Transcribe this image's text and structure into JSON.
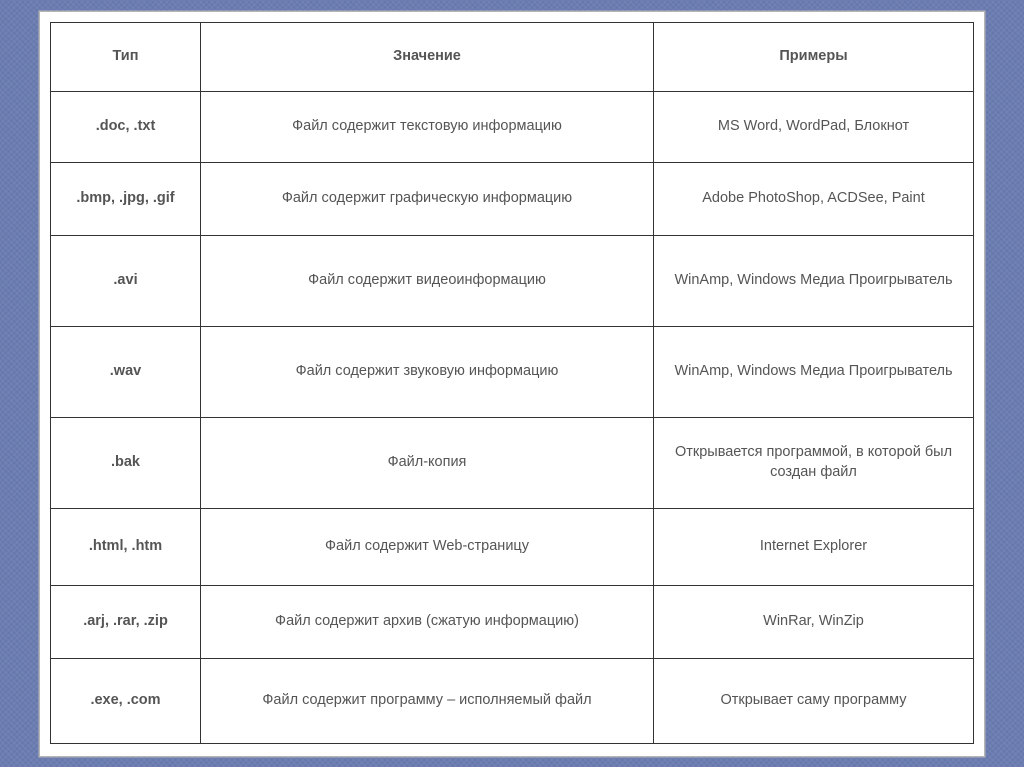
{
  "table": {
    "headers": [
      "Тип",
      "Значение",
      "Примеры"
    ],
    "rows": [
      {
        "type": ".doc,  .txt",
        "meaning": "Файл содержит текстовую информацию",
        "examples": "MS Word, WordPad, Блокнот"
      },
      {
        "type": ".bmp, .jpg, .gif",
        "meaning": "Файл содержит графическую информацию",
        "examples": "Adobe PhotoShop, ACDSee, Paint"
      },
      {
        "type": ".avi",
        "meaning": "Файл содержит видеоинформацию",
        "examples": "WinAmp, Windows Медиа Проигрыватель"
      },
      {
        "type": ".wav",
        "meaning": "Файл содержит звуковую информацию",
        "examples": "WinAmp, Windows Медиа Проигрыватель"
      },
      {
        "type": ".bak",
        "meaning": "Файл-копия",
        "examples": "Открывается программой, в которой был создан файл"
      },
      {
        "type": ".html, .htm",
        "meaning": "Файл содержит Web-страницу",
        "examples": "Internet Explorer"
      },
      {
        "type": ".arj, .rar, .zip",
        "meaning": "Файл содержит архив (сжатую информацию)",
        "examples": "WinRar, WinZip"
      },
      {
        "type": ".exe, .com",
        "meaning": "Файл содержит программу – исполняемый файл",
        "examples": "Открывает саму программу"
      }
    ]
  }
}
